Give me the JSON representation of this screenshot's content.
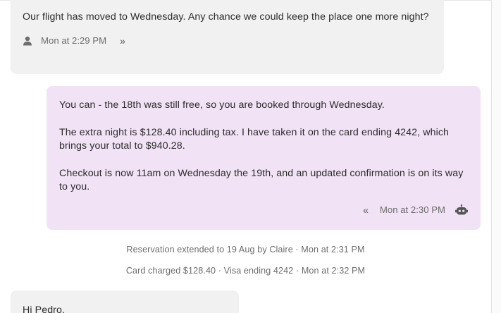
{
  "messages": {
    "guest1": {
      "text": "Our flight has moved to Wednesday. Any chance we could keep the place one more night?",
      "time": "Mon at 2:29 PM",
      "icon": "person-icon",
      "action_glyph": "»"
    },
    "host": {
      "paragraphs": [
        "You can - the 18th was still free, so you are booked through Wednesday.",
        "The extra night is $128.40 including tax. I have taken it on the card ending 4242, which brings your total to $940.28.",
        "Checkout is now 11am on Wednesday the 19th, and an updated confirmation is on its way to you."
      ],
      "time": "Mon at 2:30 PM",
      "icon": "robot-icon",
      "action_glyph": "«"
    },
    "guest2": {
      "text": "Hi Pedro,"
    }
  },
  "events": [
    "Reservation extended to 19 Aug by Claire · Mon at 2:31 PM",
    "Card charged $128.40 · Visa ending 4242 · Mon at 2:32 PM"
  ],
  "colors": {
    "guest_bubble": "#f1f1f1",
    "host_bubble": "#f1e3f5",
    "text": "#2b2b2b",
    "meta": "#6d6d6d"
  }
}
